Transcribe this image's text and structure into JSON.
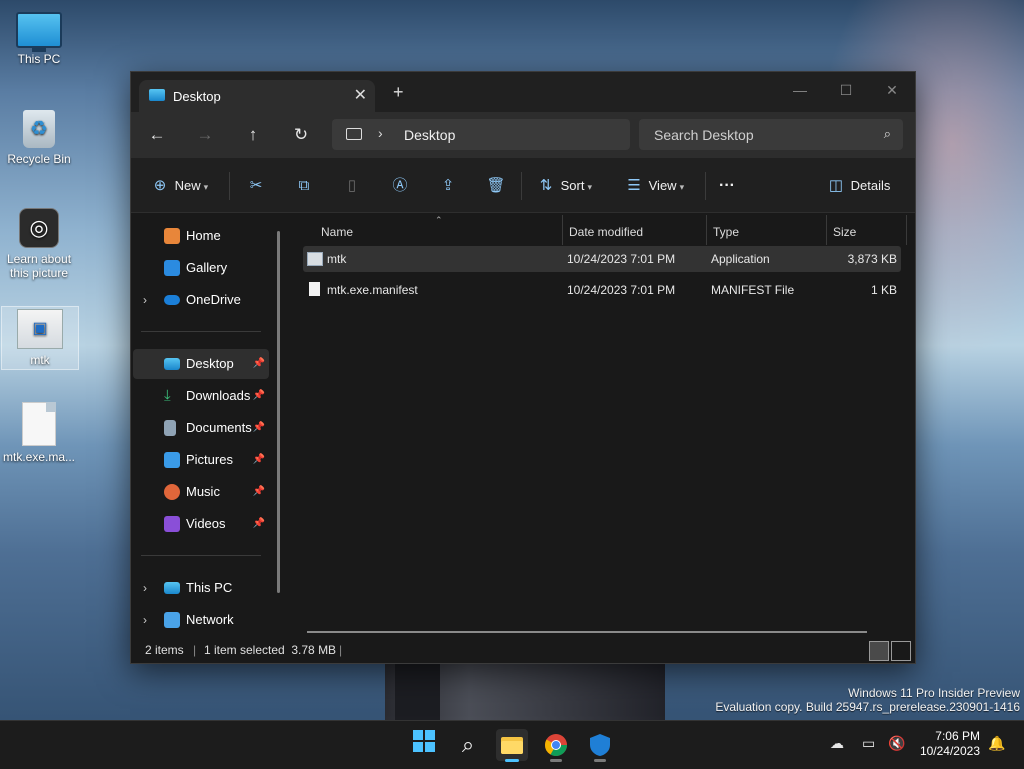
{
  "desktop": {
    "icons": [
      {
        "label": "This PC",
        "icon": "monitor-icon"
      },
      {
        "label": "Recycle Bin",
        "icon": "recycle-bin-icon"
      },
      {
        "label": "Learn about this picture",
        "icon": "camera-icon"
      },
      {
        "label": "mtk",
        "icon": "application-icon"
      },
      {
        "label": "mtk.exe.ma...",
        "icon": "file-icon"
      }
    ],
    "watermark": {
      "line1": "Windows 11 Pro Insider Preview",
      "line2": "Evaluation copy. Build 25947.rs_prerelease.230901-1416"
    }
  },
  "window": {
    "tab_title": "Desktop",
    "nav": {
      "breadcrumb": "Desktop",
      "search_placeholder": "Search Desktop"
    },
    "commands": {
      "new_label": "New",
      "sort_label": "Sort",
      "view_label": "View",
      "more_label": "···",
      "details_label": "Details"
    },
    "sidebar": {
      "quick": [
        {
          "label": "Home"
        },
        {
          "label": "Gallery"
        },
        {
          "label": "OneDrive"
        }
      ],
      "pinned": [
        {
          "label": "Desktop"
        },
        {
          "label": "Downloads"
        },
        {
          "label": "Documents"
        },
        {
          "label": "Pictures"
        },
        {
          "label": "Music"
        },
        {
          "label": "Videos"
        }
      ],
      "devices": [
        {
          "label": "This PC"
        },
        {
          "label": "Network"
        }
      ]
    },
    "columns": [
      "Name",
      "Date modified",
      "Type",
      "Size"
    ],
    "files": [
      {
        "name": "mtk",
        "date": "10/24/2023 7:01 PM",
        "type": "Application",
        "size": "3,873 KB",
        "selected": true
      },
      {
        "name": "mtk.exe.manifest",
        "date": "10/24/2023 7:01 PM",
        "type": "MANIFEST File",
        "size": "1 KB",
        "selected": false
      }
    ],
    "status": {
      "count": "2 items",
      "selection": "1 item selected  3.78 MB"
    }
  },
  "taskbar": {
    "time": "7:06 PM",
    "date": "10/24/2023"
  },
  "colors": {
    "accent": "#8ec8f7",
    "window_bg": "#191919",
    "selection": "#333333"
  }
}
